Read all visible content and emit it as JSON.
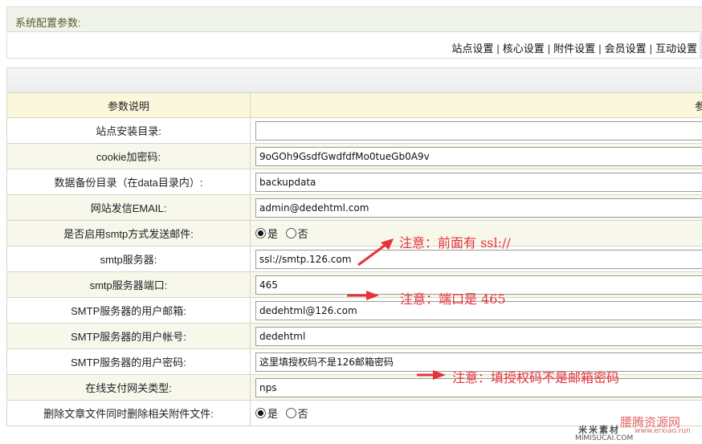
{
  "header": {
    "title": "系统配置参数:"
  },
  "nav": {
    "items": [
      "站点设置",
      "核心设置",
      "附件设置",
      "会员设置",
      "互动设置"
    ]
  },
  "table": {
    "header": {
      "label": "参数说明",
      "value": "参"
    },
    "rows": [
      {
        "label": "站点安装目录:",
        "type": "text",
        "value": ""
      },
      {
        "label": "cookie加密码:",
        "type": "text",
        "value": "9oGOh9GsdfGwdfdfMo0tueGb0A9v"
      },
      {
        "label": "数据备份目录（在data目录内）:",
        "type": "text",
        "value": "backupdata"
      },
      {
        "label": "网站发信EMAIL:",
        "type": "text",
        "value": "admin@dedehtml.com"
      },
      {
        "label": "是否启用smtp方式发送邮件:",
        "type": "radio",
        "options": [
          "是",
          "否"
        ],
        "selected": "是"
      },
      {
        "label": "smtp服务器:",
        "type": "text",
        "value": "ssl://smtp.126.com"
      },
      {
        "label": "smtp服务器端口:",
        "type": "text",
        "value": "465"
      },
      {
        "label": "SMTP服务器的用户邮箱:",
        "type": "text",
        "value": "dedehtml@126.com"
      },
      {
        "label": "SMTP服务器的用户帐号:",
        "type": "text",
        "value": "dedehtml"
      },
      {
        "label": "SMTP服务器的用户密码:",
        "type": "text",
        "value": "这里填授权码不是126邮箱密码"
      },
      {
        "label": "在线支付网关类型:",
        "type": "text",
        "value": "nps"
      },
      {
        "label": "删除文章文件同时删除相关附件文件:",
        "type": "radio",
        "options": [
          "是",
          "否"
        ],
        "selected": "是"
      }
    ]
  },
  "annotations": {
    "note1": "注意：前面有 ssl://",
    "note2": "注意：端口是 465",
    "note3": "注意：填授权码不是邮箱密码",
    "color": "#e8323a"
  },
  "watermark": {
    "site_cn": "腰腾资源网",
    "site_url": "www.erxiao.run",
    "brand": "米米素材",
    "brand_url": "MIMISUCAI.COM"
  }
}
